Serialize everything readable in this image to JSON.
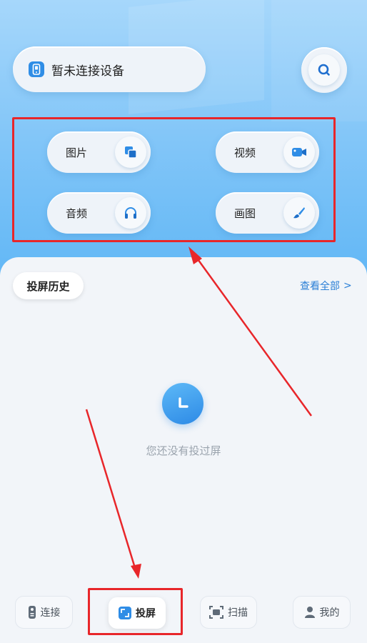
{
  "header": {
    "device_status": "暂未连接设备",
    "search_icon": "search-icon",
    "device_icon": "phone-icon"
  },
  "categories": [
    {
      "label": "图片",
      "icon": "image-icon"
    },
    {
      "label": "视频",
      "icon": "video-camera-icon"
    },
    {
      "label": "音频",
      "icon": "headphones-icon"
    },
    {
      "label": "画图",
      "icon": "paintbrush-icon"
    }
  ],
  "history": {
    "tab_label": "投屏历史",
    "view_all": "查看全部",
    "view_all_chevron": ">",
    "empty_text": "您还没有投过屏",
    "empty_icon": "clock-icon"
  },
  "bottom_nav": [
    {
      "label": "连接",
      "icon": "remote-icon",
      "active": false
    },
    {
      "label": "投屏",
      "icon": "cast-screen-icon",
      "active": true
    },
    {
      "label": "扫描",
      "icon": "scan-icon",
      "active": false
    },
    {
      "label": "我的",
      "icon": "user-icon",
      "active": false
    }
  ],
  "colors": {
    "accent": "#2f8de6",
    "annotation_red": "#e8262a",
    "link_blue": "#2b7fd6"
  }
}
